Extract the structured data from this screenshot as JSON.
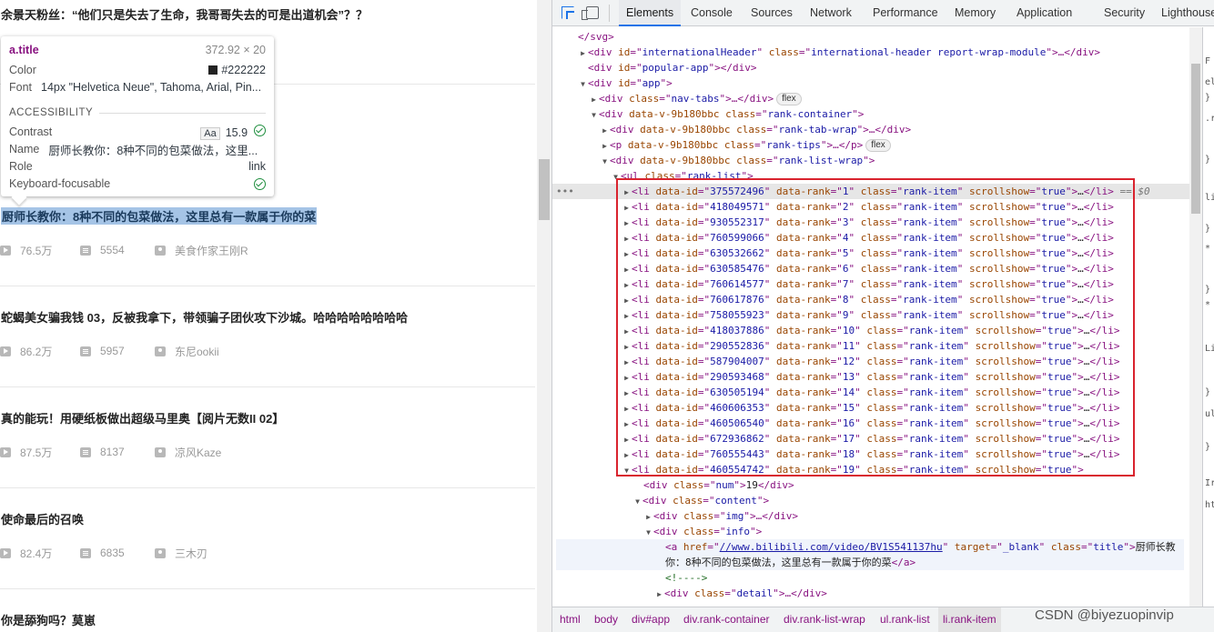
{
  "left_page": {
    "items": [
      {
        "title": "余景天粉丝：“他们只是失去了生命，我哥哥失去的可是出道机会”？？",
        "plays": "",
        "danmaku": "",
        "uploader": ""
      },
      {
        "title": "厨师长教你：8种不同的包菜做法，这里总有一款属于你的菜",
        "plays": "76.5万",
        "danmaku": "5554",
        "uploader": "美食作家王刚R"
      },
      {
        "title": "蛇蝎美女骗我钱 03，反被我拿下，带领骗子团伙攻下沙城。哈哈哈哈哈哈哈哈",
        "plays": "86.2万",
        "danmaku": "5957",
        "uploader": "东尼ookii"
      },
      {
        "title": "真的能玩！用硬纸板做出超级马里奥【阅片无数II 02】",
        "plays": "87.5万",
        "danmaku": "8137",
        "uploader": "凉风Kaze"
      },
      {
        "title": "使命最后的召唤",
        "plays": "82.4万",
        "danmaku": "6835",
        "uploader": "三木刃"
      },
      {
        "title": "你是舔狗吗？莫崽",
        "plays": "",
        "danmaku": "",
        "uploader": ""
      }
    ],
    "tooltip": {
      "element": "a.title",
      "size": "372.92 × 20",
      "color_label": "Color",
      "color_value": "#222222",
      "font_label": "Font",
      "font_value": "14px \"Helvetica Neue\", Tahoma, Arial, Pin...",
      "section": "ACCESSIBILITY",
      "contrast_label": "Contrast",
      "contrast_aa": "Aa",
      "contrast_value": "15.9",
      "name_label": "Name",
      "name_value": "厨师长教你：8种不同的包菜做法，这里...",
      "role_label": "Role",
      "role_value": "link",
      "kb_label": "Keyboard-focusable"
    }
  },
  "devtools": {
    "tabs": [
      "Elements",
      "Console",
      "Sources",
      "Network",
      "Performance",
      "Memory",
      "Application",
      "Security",
      "Lighthouse"
    ],
    "active_tab": "Elements",
    "dom_lines": {
      "l0": "</svg>",
      "l1_id": "internationalHeader",
      "l1_class": "international-header report-wrap-module",
      "l2_id": "popular-app",
      "l3_id": "app",
      "l4_class": "nav-tabs",
      "flex_badge": "flex",
      "l5_attr": "data-v-9b180bbc",
      "l5_class": "rank-container",
      "l6_class": "rank-tab-wrap",
      "l7_class": "rank-tips",
      "l8_class": "rank-list-wrap",
      "l9_class": "rank-list",
      "li_class": "rank-item",
      "li_scroll": "true",
      "eq_sel": "== $0",
      "num_class": "num",
      "num_value": "19",
      "content_class": "content",
      "img_class": "img",
      "info_class": "info",
      "a_href": "//www.bilibili.com/video/BV1S541137hu",
      "a_target": "_blank",
      "a_class": "title",
      "a_text1": "厨师长教",
      "a_text2": "你：8种不同的包菜做法，这里总有一款属于你的菜",
      "comment": "<!---->",
      "detail_class": "detail"
    },
    "list_items": [
      {
        "id": "375572496",
        "rank": "1"
      },
      {
        "id": "418049571",
        "rank": "2"
      },
      {
        "id": "930552317",
        "rank": "3"
      },
      {
        "id": "760599066",
        "rank": "4"
      },
      {
        "id": "630532662",
        "rank": "5"
      },
      {
        "id": "630585476",
        "rank": "6"
      },
      {
        "id": "760614577",
        "rank": "7"
      },
      {
        "id": "760617876",
        "rank": "8"
      },
      {
        "id": "758055923",
        "rank": "9"
      },
      {
        "id": "418037886",
        "rank": "10"
      },
      {
        "id": "290552836",
        "rank": "11"
      },
      {
        "id": "587904007",
        "rank": "12"
      },
      {
        "id": "290593468",
        "rank": "13"
      },
      {
        "id": "630505194",
        "rank": "14"
      },
      {
        "id": "460606353",
        "rank": "15"
      },
      {
        "id": "460506540",
        "rank": "16"
      },
      {
        "id": "672936862",
        "rank": "17"
      },
      {
        "id": "760555443",
        "rank": "18"
      },
      {
        "id": "460554742",
        "rank": "19"
      }
    ],
    "breadcrumbs": [
      "html",
      "body",
      "div#app",
      "div.rank-container",
      "div.rank-list-wrap",
      "ul.rank-list",
      "li.rank-item"
    ],
    "side_pane": [
      "F",
      "el",
      "}",
      ".r",
      "}",
      "li",
      "}",
      "*",
      "}",
      "*",
      "Li",
      "}",
      "ul",
      "}",
      "Ir",
      "ht"
    ]
  },
  "watermark": "CSDN @biyezuopinvip",
  "colors": {
    "selection": "#a5c4e6",
    "accent": "#1a73e8",
    "red_box": "#d9232e",
    "tag": "#881280"
  }
}
